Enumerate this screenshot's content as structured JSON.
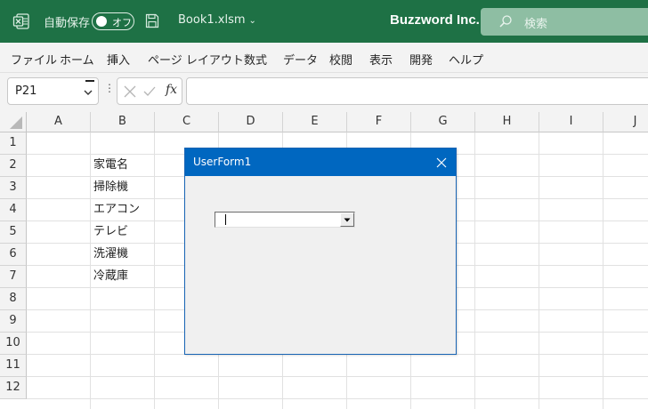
{
  "titlebar": {
    "autosave_label": "自動保存",
    "autosave_state": "オフ",
    "filename": "Book1.xlsm",
    "company": "Buzzword Inc.",
    "search_placeholder": "検索",
    "bg_color": "#1e7145"
  },
  "menu": {
    "items": [
      "ファイル",
      "ホーム",
      "挿入",
      "ページ レイアウト",
      "数式",
      "データ",
      "校閲",
      "表示",
      "開発",
      "ヘルプ"
    ]
  },
  "formula_bar": {
    "namebox_value": "P21",
    "fx_label": "fx",
    "formula_value": ""
  },
  "grid": {
    "columns": [
      "A",
      "B",
      "C",
      "D",
      "E",
      "F",
      "G",
      "H",
      "I",
      "J"
    ],
    "rows": [
      "1",
      "2",
      "3",
      "4",
      "5",
      "6",
      "7",
      "8",
      "9",
      "10",
      "11",
      "12"
    ],
    "cells": {
      "B2": "家電名",
      "B3": "掃除機",
      "B4": "エアコン",
      "B5": "テレビ",
      "B6": "洗濯機",
      "B7": "冷蔵庫"
    }
  },
  "userform": {
    "title": "UserForm1",
    "combobox_value": "",
    "title_color": "#0067c0"
  }
}
